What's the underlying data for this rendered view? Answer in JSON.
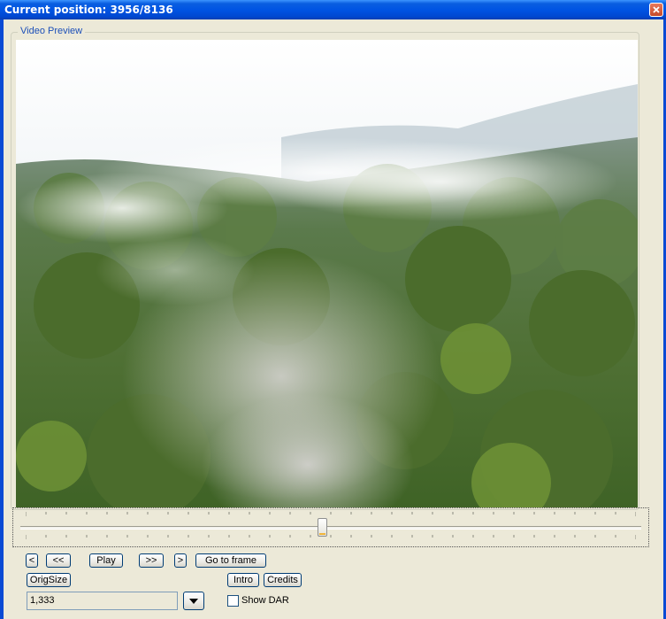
{
  "window": {
    "title": "Current position: 3956/8136",
    "close_icon": "close-icon"
  },
  "preview": {
    "group_label": "Video Preview",
    "image": "misty-rainforest-canopy"
  },
  "seekbar": {
    "position": 3956,
    "total": 8136
  },
  "controls": {
    "prev_frame": "<",
    "rewind": "<<",
    "play": "Play",
    "forward": ">>",
    "next_frame": ">",
    "goto_frame": "Go to frame",
    "orig_size": "OrigSize",
    "intro": "Intro",
    "credits": "Credits",
    "aspect_value": "1,333",
    "show_dar": "Show DAR",
    "show_dar_checked": false
  }
}
